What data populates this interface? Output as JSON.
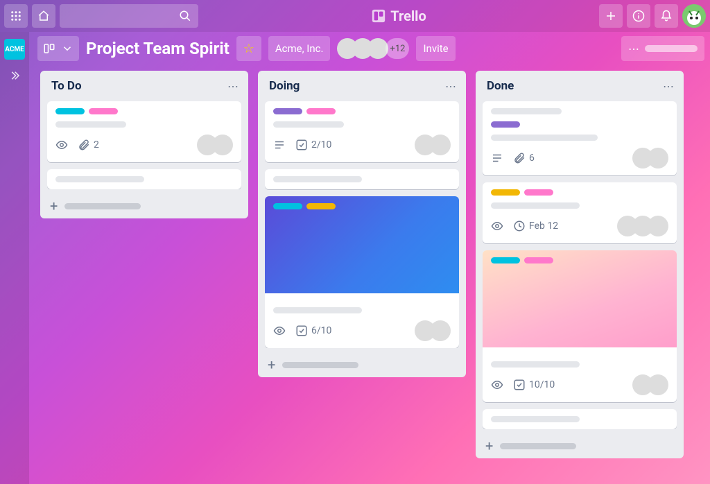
{
  "app": {
    "name": "Trello"
  },
  "board": {
    "title": "Project Team Spirit",
    "workspace": "Acme, Inc.",
    "extra_members": "+12",
    "invite_label": "Invite",
    "workspace_badge": "ACME"
  },
  "lists": [
    {
      "title": "To Do",
      "cards": [
        {
          "labels": [
            "cyan",
            "pink"
          ],
          "badges": {
            "watch": true,
            "attachments": "2"
          },
          "members": [
            "av3",
            "av2"
          ]
        },
        {
          "placeholder_only": true
        }
      ]
    },
    {
      "title": "Doing",
      "cards": [
        {
          "labels": [
            "purple",
            "pink"
          ],
          "badges": {
            "description": true,
            "checklist": "2/10"
          },
          "members": [
            "av1",
            "av2"
          ]
        },
        {
          "placeholder_only": true
        },
        {
          "cover": "blue",
          "cover_labels": [
            "cyan",
            "yellow"
          ],
          "badges": {
            "watch": true,
            "checklist": "6/10"
          },
          "members": [
            "av3",
            "av2"
          ]
        }
      ]
    },
    {
      "title": "Done",
      "cards": [
        {
          "labels": [
            "purple"
          ],
          "two_lines": true,
          "badges": {
            "description": true,
            "attachments": "6"
          },
          "members": [
            "av4",
            "av3"
          ]
        },
        {
          "labels": [
            "yellow",
            "pink"
          ],
          "badges": {
            "watch": true,
            "due": "Feb 12"
          },
          "members": [
            "av1",
            "av5",
            "av2"
          ]
        },
        {
          "cover": "pink",
          "cover_labels": [
            "cyan",
            "pink"
          ],
          "badges": {
            "watch": true,
            "checklist": "10/10"
          },
          "members": [
            "av1",
            "av4"
          ]
        },
        {
          "placeholder_only": true
        }
      ]
    }
  ]
}
